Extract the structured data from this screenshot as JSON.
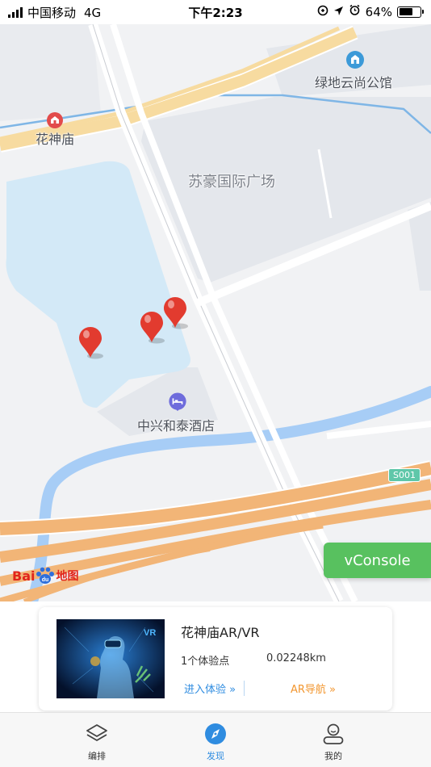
{
  "status_bar": {
    "carrier": "中国移动",
    "network": "4G",
    "time": "下午2:23",
    "battery": "64%",
    "battery_level": 0.64
  },
  "map": {
    "labels": {
      "huashenmiao": "花神庙",
      "lvdi": "绿地云尚公馆",
      "suhao": "苏豪国际广场",
      "zhongxing": "中兴和泰酒店"
    },
    "road_shield": "S001",
    "logo": "Baidu地图",
    "colors": {
      "background": "#f1f2f4",
      "block": "#e4e7ec",
      "water": "#d3e9f7",
      "river": "#a7cdf6",
      "highway": "#f2b577",
      "major_road": "#f7dba0",
      "pin": "#e23b2f"
    }
  },
  "vconsole": {
    "label": "vConsole"
  },
  "card": {
    "title": "花神庙AR/VR",
    "count": "1个体验点",
    "distance": "0.02248km",
    "enter_label": "进入体验 »",
    "nav_label": "AR导航 »",
    "accent_blue": "#2f8ce0",
    "accent_orange": "#f2962f"
  },
  "tabbar": {
    "tabs": [
      {
        "label": "编排",
        "icon": "layers-icon"
      },
      {
        "label": "发现",
        "icon": "compass-icon"
      },
      {
        "label": "我的",
        "icon": "user-icon"
      }
    ],
    "active_index": 1
  }
}
